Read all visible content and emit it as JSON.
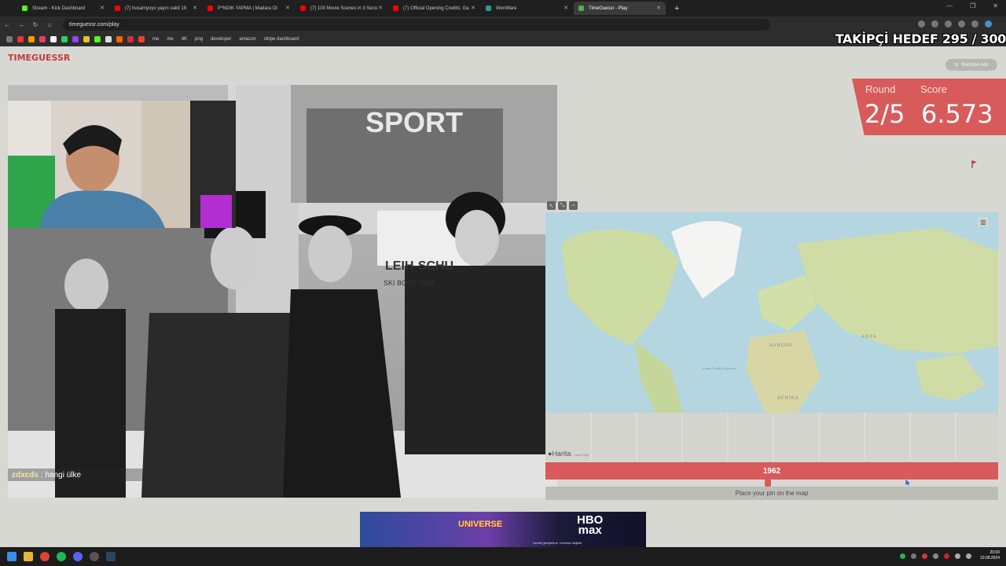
{
  "browser": {
    "tabs": [
      {
        "title": "Stream - Kick Dashboard",
        "color": "#53fc18"
      },
      {
        "title": "(7) husamyoyo yayın vakti 19",
        "color": "#ff0000"
      },
      {
        "title": "P*NOIK YAPMA | Madara Ol",
        "color": "#ff0000"
      },
      {
        "title": "(7) 100 Movie Scenes in 3 Seco",
        "color": "#ff0000"
      },
      {
        "title": "(7) Official Opening Credits: Ga",
        "color": "#ff0000"
      },
      {
        "title": "WenWare",
        "color": "#2a9d8f"
      },
      {
        "title": "TimeGuessr - Play",
        "color": "#4caf50",
        "active": true
      }
    ],
    "url": "timeguessr.com/play",
    "bookmarks": [
      "me",
      "me",
      "4K",
      "png",
      "developer",
      "amazon",
      "stripe dashboard"
    ]
  },
  "overlay": {
    "follower_goal": "TAKİPÇİ HEDEF 295 / 300",
    "chat_user": "zdxcds",
    "chat_message": ": hangi ülke"
  },
  "game": {
    "logo": "TIMEGUESSR",
    "remove_ads": "Remove Ads",
    "round_label": "Round",
    "round_value": "2/5",
    "score_label": "Score",
    "score_value": "6.573",
    "photo_sign_1": "SPORT",
    "photo_sign_2": "LEIH-SCHU",
    "photo_sign_3": "SKI BOOT HIRE",
    "map_labels": {
      "europe": "AVRUPA",
      "asia": "ASYA",
      "africa": "AFRİKA",
      "pacific": "Kuzey Pasifik Okyanusu"
    },
    "map_brand": "Harita",
    "map_brand_sub": "Yasal Bilgi",
    "year": "1962",
    "place_pin": "Place your pin on the map",
    "accent": "#d85a5a"
  },
  "ad": {
    "headline": "UNIVERSE",
    "brand_line1": "HBO",
    "brand_line2": "max",
    "fineprint": "Ücretli genişletme. Ücretsiz değildir."
  },
  "taskbar": {
    "time": "20:00",
    "date": "10.08.2024"
  }
}
